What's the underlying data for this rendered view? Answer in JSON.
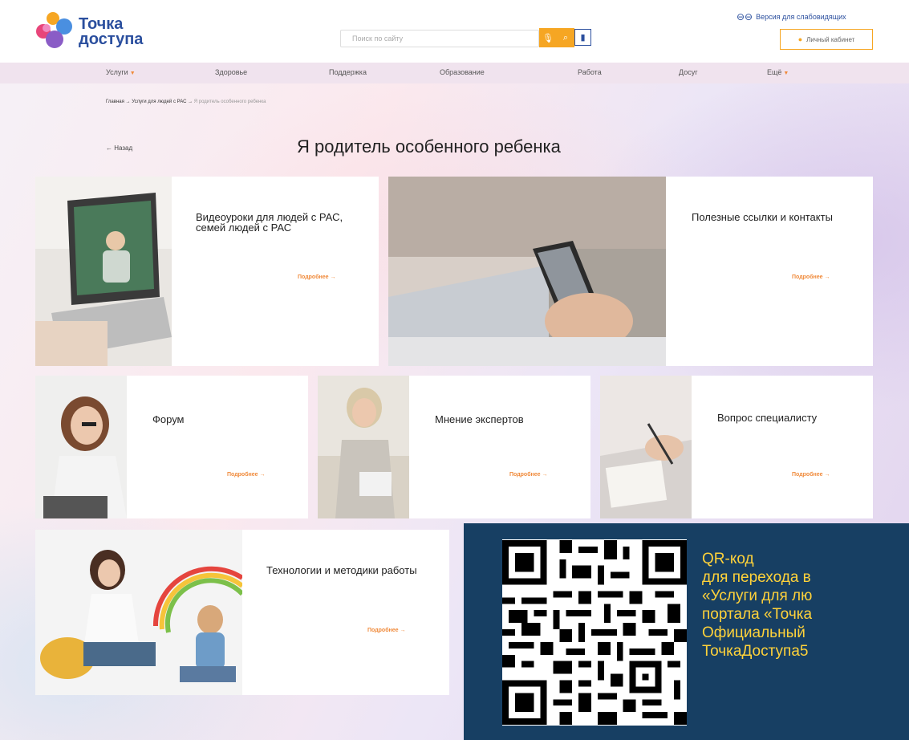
{
  "header": {
    "logo_line1": "Точка",
    "logo_line2": "доступа",
    "search_placeholder": "Поиск по сайту",
    "low_vision_label": "Версия для слабовидящих",
    "cabinet_label": "Личный кабинет",
    "icons": [
      "glasses-icon",
      "mic-icon",
      "search-icon",
      "book-icon",
      "user-icon"
    ]
  },
  "nav": {
    "items": [
      {
        "label": "Услуги",
        "has_caret": true
      },
      {
        "label": "Здоровье"
      },
      {
        "label": "Поддержка"
      },
      {
        "label": "Образование"
      },
      {
        "label": "Работа"
      },
      {
        "label": "Досуг"
      },
      {
        "label": "Ещё",
        "has_caret": true
      }
    ]
  },
  "breadcrumb": {
    "items": [
      "Главная",
      "Услуги для людей с РАС",
      "Я родитель особенного ребенка"
    ],
    "separator": "→"
  },
  "page": {
    "back_label": "← Назад",
    "title": "Я родитель особенного ребенка"
  },
  "cards": [
    {
      "title": "Видеоуроки для людей с РАС, семей людей с РАС",
      "more": "Подробнее →",
      "image": "laptop-video-lesson"
    },
    {
      "title": "Полезные ссылки и контакты",
      "more": "Подробнее →",
      "image": "hands-phone-laptop"
    },
    {
      "title": "Форум",
      "more": "Подробнее →",
      "image": "woman-with-laptop"
    },
    {
      "title": "Мнение экспертов",
      "more": "Подробнее →",
      "image": "smiling-expert-woman"
    },
    {
      "title": "Вопрос специалисту",
      "more": "Подробнее →",
      "image": "specialist-writing"
    },
    {
      "title": "Технологии и методики работы",
      "more": "Подробнее →",
      "image": "woman-and-child"
    }
  ],
  "qr": {
    "lines": [
      "QR-код",
      "для перехода в",
      "«Услуги для лю",
      "портала «Точка",
      "Официальный",
      "ТочкаДоступа5"
    ]
  },
  "colors": {
    "brand_blue": "#2b4f9e",
    "accent_orange": "#f08a3a",
    "search_yellow": "#f6a623",
    "qr_bg": "#173f63",
    "qr_text": "#ffd23a"
  }
}
